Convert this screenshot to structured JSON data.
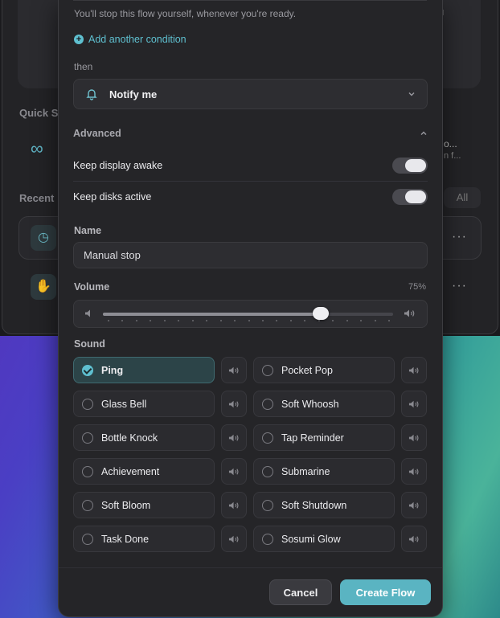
{
  "background": {
    "quick_label": "Quick S",
    "recent_label": "Recent",
    "all_label": "All",
    "side_title": "o...",
    "side_sub": "n f..."
  },
  "modal": {
    "hint": "You'll stop this flow yourself, whenever you're ready.",
    "add_condition": "Add another condition",
    "then_label": "then",
    "action_select": "Notify me",
    "advanced_label": "Advanced",
    "keep_display_awake": "Keep display awake",
    "keep_disks_active": "Keep disks active",
    "toggles": {
      "display_awake_on": true,
      "disks_active_on": true
    },
    "name_label": "Name",
    "name_value": "Manual stop",
    "volume_label": "Volume",
    "volume_percent": "75%",
    "volume_value": 0.75,
    "sound_label": "Sound",
    "sounds": [
      {
        "name": "Ping",
        "selected": true
      },
      {
        "name": "Pocket Pop",
        "selected": false
      },
      {
        "name": "Glass Bell",
        "selected": false
      },
      {
        "name": "Soft Whoosh",
        "selected": false
      },
      {
        "name": "Bottle Knock",
        "selected": false
      },
      {
        "name": "Tap Reminder",
        "selected": false
      },
      {
        "name": "Achievement",
        "selected": false
      },
      {
        "name": "Submarine",
        "selected": false
      },
      {
        "name": "Soft Bloom",
        "selected": false
      },
      {
        "name": "Soft Shutdown",
        "selected": false
      },
      {
        "name": "Task Done",
        "selected": false
      },
      {
        "name": "Sosumi Glow",
        "selected": false
      }
    ],
    "cancel_label": "Cancel",
    "create_label": "Create Flow"
  },
  "colors": {
    "accent": "#5fc0d0",
    "primary_button": "#5ab4c2",
    "modal_bg": "#252528"
  },
  "icons": {
    "add": "plus-circle-icon",
    "action": "bell-icon",
    "dropdown": "chevron-down-icon",
    "collapse": "chevron-up-icon",
    "volume_low": "speaker-low-icon",
    "volume_high": "speaker-high-icon",
    "play": "speaker-icon",
    "selected": "check-circle-icon"
  }
}
